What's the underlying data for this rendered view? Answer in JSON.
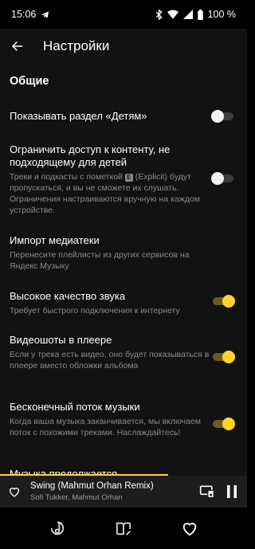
{
  "status_bar": {
    "time": "15:06",
    "battery": "100 %",
    "icons": [
      "telegram-icon",
      "bluetooth-icon",
      "wifi-icon",
      "signal-icon",
      "battery-icon"
    ]
  },
  "header": {
    "title": "Настройки",
    "back_icon": "arrow-left-icon"
  },
  "section": {
    "title": "Общие"
  },
  "settings": [
    {
      "title": "Показывать раздел «Детям»",
      "description": "",
      "toggle": "off"
    },
    {
      "title": "Ограничить доступ к контенту, не подходящему для детей",
      "description_before": "Треки и подкасты с пометкой",
      "badge": "E",
      "description_after": "(Explicit) будут пропускаться, и вы не сможете их слушать. Ограничения настраиваются вручную на каждом устройстве.",
      "toggle": "off"
    },
    {
      "title": "Импорт медиатеки",
      "description": "Перенесите плейлисты из других сервисов на Яндекс Музыку"
    },
    {
      "title": "Высокое качество звука",
      "description": "Требует быстрого подключения к интернету",
      "toggle": "on"
    },
    {
      "title": "Видеошоты в плеере",
      "description": "Если у трека есть видео, оно будет показываться в плеере вместо обложки альбома",
      "toggle": "on"
    },
    {
      "title": "Бесконечный поток музыки",
      "description": "Когда ваша музыка заканчивается, мы включаем поток с похожими треками. Наслаждайтесь!",
      "toggle": "on"
    },
    {
      "title": "Музыка продолжается"
    }
  ],
  "player": {
    "track_title": "Swing (Mahmut Orhan Remix)",
    "artist": "Sofi Tukker, Mahmut Orhan",
    "progress": 0.68,
    "icons": [
      "heart-icon",
      "cast-icon",
      "pause-icon"
    ]
  },
  "bottom_nav": {
    "items": [
      "music-note-icon",
      "book-icon",
      "heart-icon"
    ]
  },
  "colors": {
    "accent": "#fed42b",
    "background": "#121212",
    "secondary_text": "#8a8a8a"
  }
}
